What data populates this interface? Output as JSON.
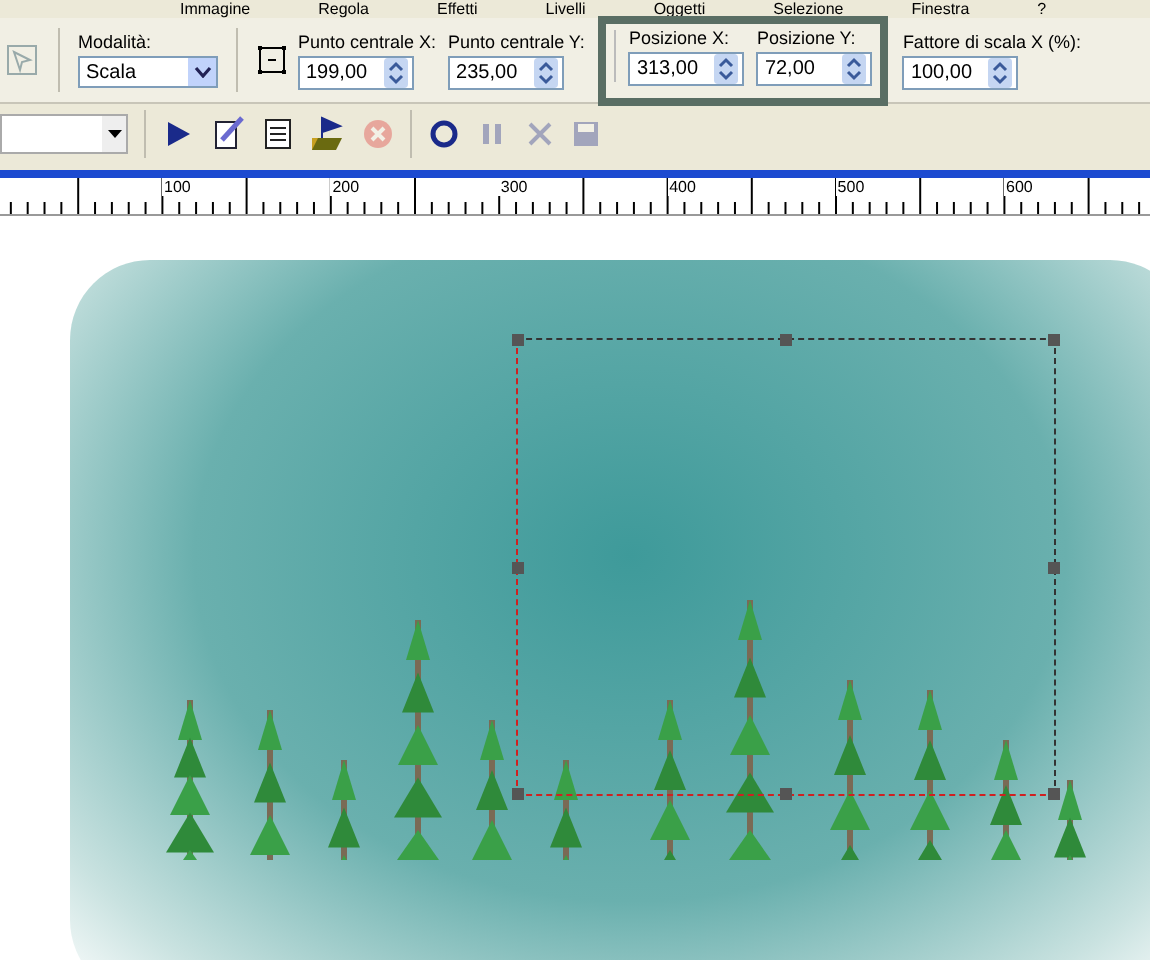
{
  "menu": [
    "Immagine",
    "Regola",
    "Effetti",
    "Livelli",
    "Oggetti",
    "Selezione",
    "Finestra",
    "?"
  ],
  "tool_options": {
    "mode": {
      "label": "Modalità:",
      "value": "Scala"
    },
    "fields": [
      {
        "label": "Punto centrale X:",
        "value": "199,00",
        "highlighted": false
      },
      {
        "label": "Punto centrale Y:",
        "value": "235,00",
        "highlighted": false
      },
      {
        "label": "Posizione X:",
        "value": "313,00",
        "highlighted": true
      },
      {
        "label": "Posizione Y:",
        "value": "72,00",
        "highlighted": true
      },
      {
        "label": "Fattore di scala X (%):",
        "value": "100,00",
        "highlighted": false
      }
    ]
  },
  "script_toolbar": {
    "buttons": [
      {
        "kind": "play",
        "disabled": false
      },
      {
        "kind": "edit",
        "disabled": false
      },
      {
        "kind": "list",
        "disabled": false
      },
      {
        "kind": "run",
        "disabled": false
      },
      {
        "kind": "stop",
        "disabled": true
      },
      {
        "kind": "record",
        "disabled": false
      },
      {
        "kind": "pause",
        "disabled": true
      },
      {
        "kind": "cancel",
        "disabled": true
      },
      {
        "kind": "save",
        "disabled": true
      }
    ]
  },
  "ruler": [
    "100",
    "200",
    "300",
    "400",
    "500",
    "600"
  ]
}
